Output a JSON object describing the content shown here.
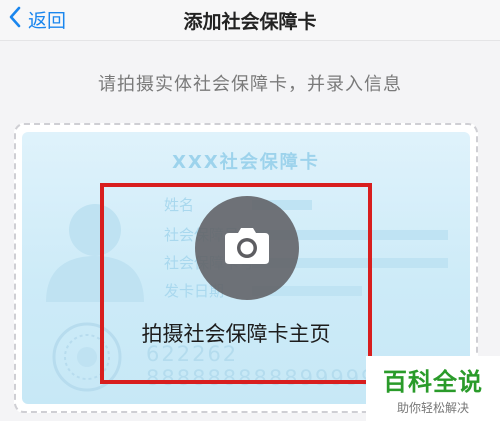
{
  "nav": {
    "back_label": "返回",
    "title": "添加社会保障卡"
  },
  "instruction": "请拍摄实体社会保障卡，并录入信息",
  "card_preview": {
    "title": "XXX社会保障卡",
    "fields": [
      "姓名",
      "社会保障号码",
      "社会保障卡号",
      "发卡日期"
    ],
    "number": "622262 888888888899999"
  },
  "capture": {
    "icon": "camera-icon",
    "label": "拍摄社会保障卡主页"
  },
  "watermark": {
    "brand": "百科全说",
    "slogan": "助你轻松解决"
  },
  "colors": {
    "accent": "#1a86ee",
    "guide_border": "#d81e1e",
    "card_tint": "#cdebf8",
    "brand_green": "#2a9b2a"
  }
}
